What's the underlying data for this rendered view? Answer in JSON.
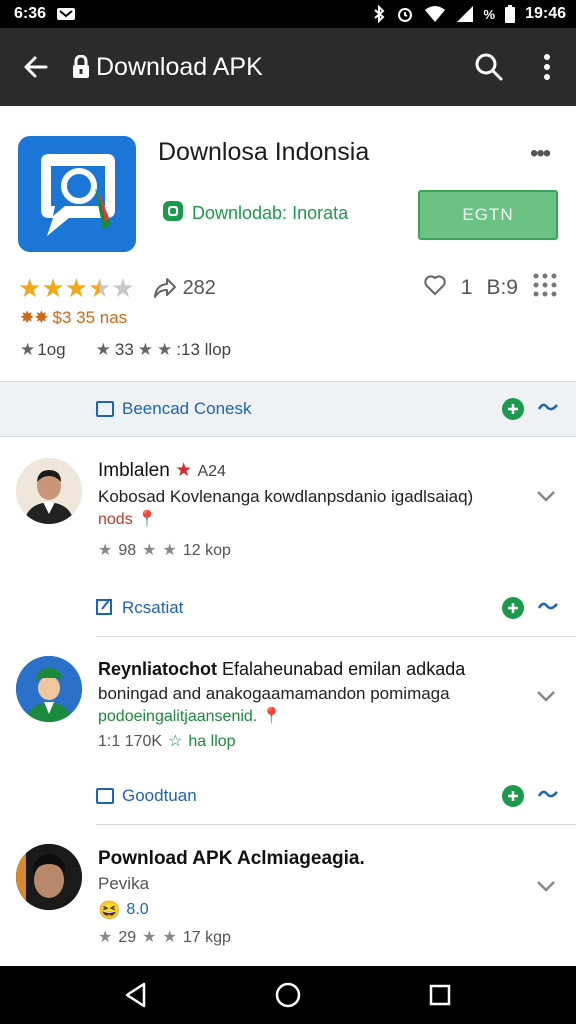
{
  "status_bar": {
    "time_left": "6:36",
    "time_right": "19:46",
    "battery_label": "%"
  },
  "toolbar": {
    "title": "Download APK"
  },
  "app": {
    "name": "Downlosa Indonsia",
    "developer": "Downlodab: Inorata",
    "install_label": "EGTN",
    "rating_stars": 3.5,
    "share_count": "282",
    "likes_count": "1",
    "likes_extra": "B:9",
    "sub_rating": "$3 35 nas",
    "stat_a": "1og",
    "stat_b": "33",
    "stat_c": ":13 llop"
  },
  "sections": [
    {
      "label": "Beencad Conesk"
    },
    {
      "label": "Rcsatiat"
    },
    {
      "label": "Goodtuan"
    }
  ],
  "reviews": [
    {
      "name": "Imblalen",
      "badge": "A24",
      "text": "Kobosad Kovlenanga kowdlanpsdanio igadlsaiaq)",
      "tag": "nods",
      "tag_color": "#c0392b",
      "stat_a": "98",
      "stat_b": "12 kop"
    },
    {
      "name": "Reynliatochot",
      "text_1": "Efalaheunabad emilan adkada",
      "text_2": "boningad and anakogaamamandon pomimaga",
      "tag": "podoeingalitjaansenid.",
      "tag_color": "#1b8a3c",
      "stat_a": "1:1 170K",
      "stat_b": "ha llop"
    },
    {
      "name": "Pownload APK Aclmiageagia.",
      "sub": "Pevika",
      "emoji_val": "8.0",
      "stat_a": "29",
      "stat_b": "17 kgp"
    }
  ],
  "colors": {
    "toolbar_bg": "#2b2b2b",
    "accent_blue": "#1d63b4",
    "accent_green": "#1b9a4c",
    "star": "#f3a71b"
  }
}
